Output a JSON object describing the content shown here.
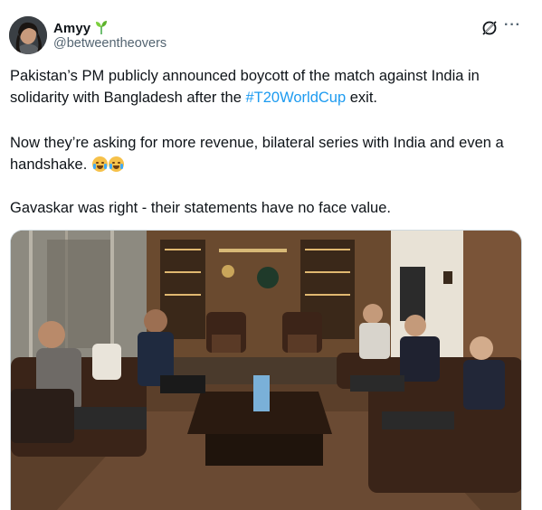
{
  "author": {
    "display_name": "Amyy",
    "name_emoji": "seedling-icon",
    "handle": "@betweentheovers"
  },
  "actions": {
    "grok_icon": "grok-icon",
    "more_label": "···"
  },
  "tweet": {
    "p1_before": "Pakistan’s PM publicly announced  boycott of the match against India in solidarity with Bangladesh after the ",
    "p1_hashtag": "#T20WorldCup",
    "p1_after": " exit.",
    "p2": "Now they’re asking for more revenue, bilateral series with India and even a handshake.",
    "p2_emojis": [
      "loudly-crying-face-icon",
      "face-with-tears-of-joy-icon"
    ],
    "p3": "Gavaskar was right - their statements have no face value."
  },
  "colors": {
    "text": "#0f1419",
    "secondary": "#536471",
    "link": "#1d9bf0",
    "seedling": "#4caf50"
  },
  "media": {
    "type": "photo",
    "scene": "meeting-room-photo"
  }
}
